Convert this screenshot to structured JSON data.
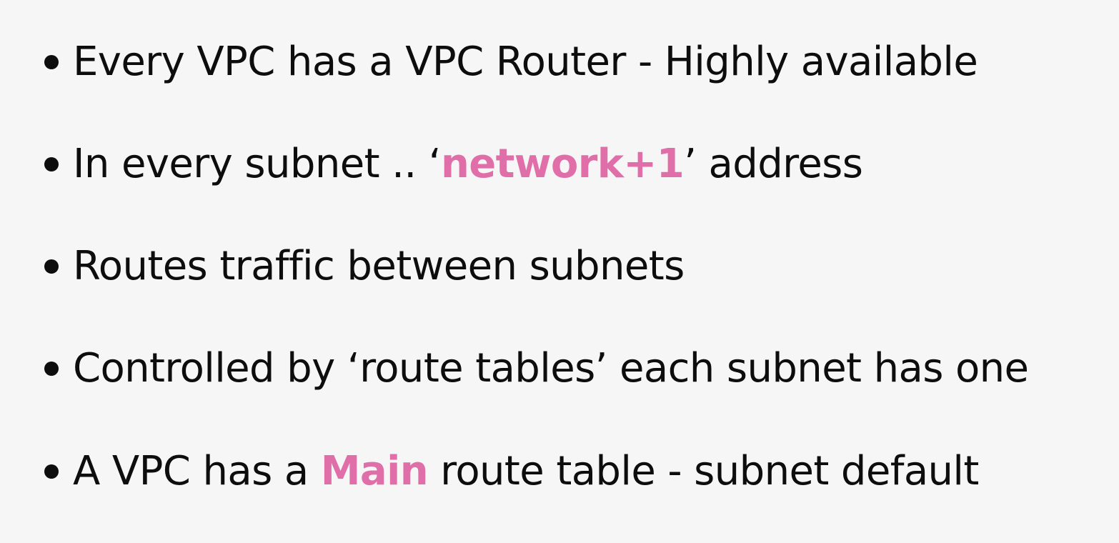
{
  "accent_color": "#e06ea8",
  "text_color": "#0d0d0d",
  "background_color": "#f6f6f6",
  "bullets": [
    {
      "text": "Every VPC has a VPC Router - Highly available"
    },
    {
      "before": "In every subnet .. ‘",
      "highlight": "network+1",
      "after": "’ address"
    },
    {
      "text": "Routes traffic between subnets"
    },
    {
      "text": "Controlled by ‘route tables’ each subnet has one"
    },
    {
      "before": "A VPC has a ",
      "highlight": "Main",
      "after": " route table - subnet default"
    }
  ]
}
